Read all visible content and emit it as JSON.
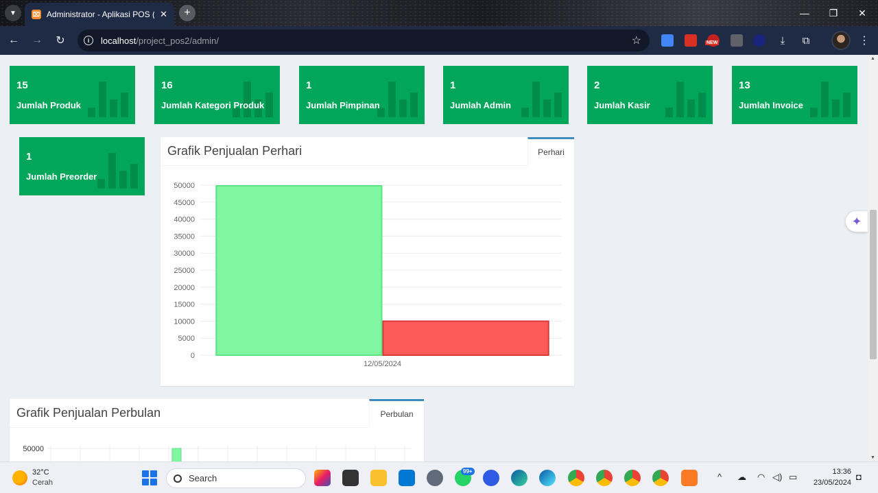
{
  "browser": {
    "tab_title": "Administrator - Aplikasi POS (P",
    "url_host": "localhost",
    "url_path": "/project_pos2/admin/",
    "new_badge": "NEW"
  },
  "stat_boxes": [
    {
      "value": "15",
      "label": "Jumlah Produk"
    },
    {
      "value": "16",
      "label": "Jumlah Kategori Produk"
    },
    {
      "value": "1",
      "label": "Jumlah Pimpinan"
    },
    {
      "value": "1",
      "label": "Jumlah Admin"
    },
    {
      "value": "2",
      "label": "Jumlah Kasir"
    },
    {
      "value": "13",
      "label": "Jumlah Invoice"
    },
    {
      "value": "1",
      "label": "Jumlah Preorder"
    }
  ],
  "daily_panel": {
    "title": "Grafik Penjualan Perhari",
    "tab": "Perhari"
  },
  "monthly_panel": {
    "title": "Grafik Penjualan Perbulan",
    "tab": "Perbulan"
  },
  "chart_data": [
    {
      "type": "bar",
      "title": "Grafik Penjualan Perhari",
      "categories": [
        "12/05/2024"
      ],
      "series": [
        {
          "values": [
            49800
          ],
          "color": "#80f5a2"
        },
        {
          "values": [
            10000
          ],
          "color": "#ff5a5a"
        }
      ],
      "ylim": [
        0,
        50000
      ],
      "yticks": [
        0,
        5000,
        10000,
        15000,
        20000,
        25000,
        30000,
        35000,
        40000,
        45000,
        50000
      ],
      "grid": true
    },
    {
      "type": "bar",
      "title": "Grafik Penjualan Perbulan",
      "visible_tick": "50000",
      "partial": true
    }
  ],
  "taskbar": {
    "temperature": "32°C",
    "condition": "Cerah",
    "search_placeholder": "Search",
    "whatsapp_badge": "99+",
    "time": "13:36",
    "date": "23/05/2024"
  }
}
